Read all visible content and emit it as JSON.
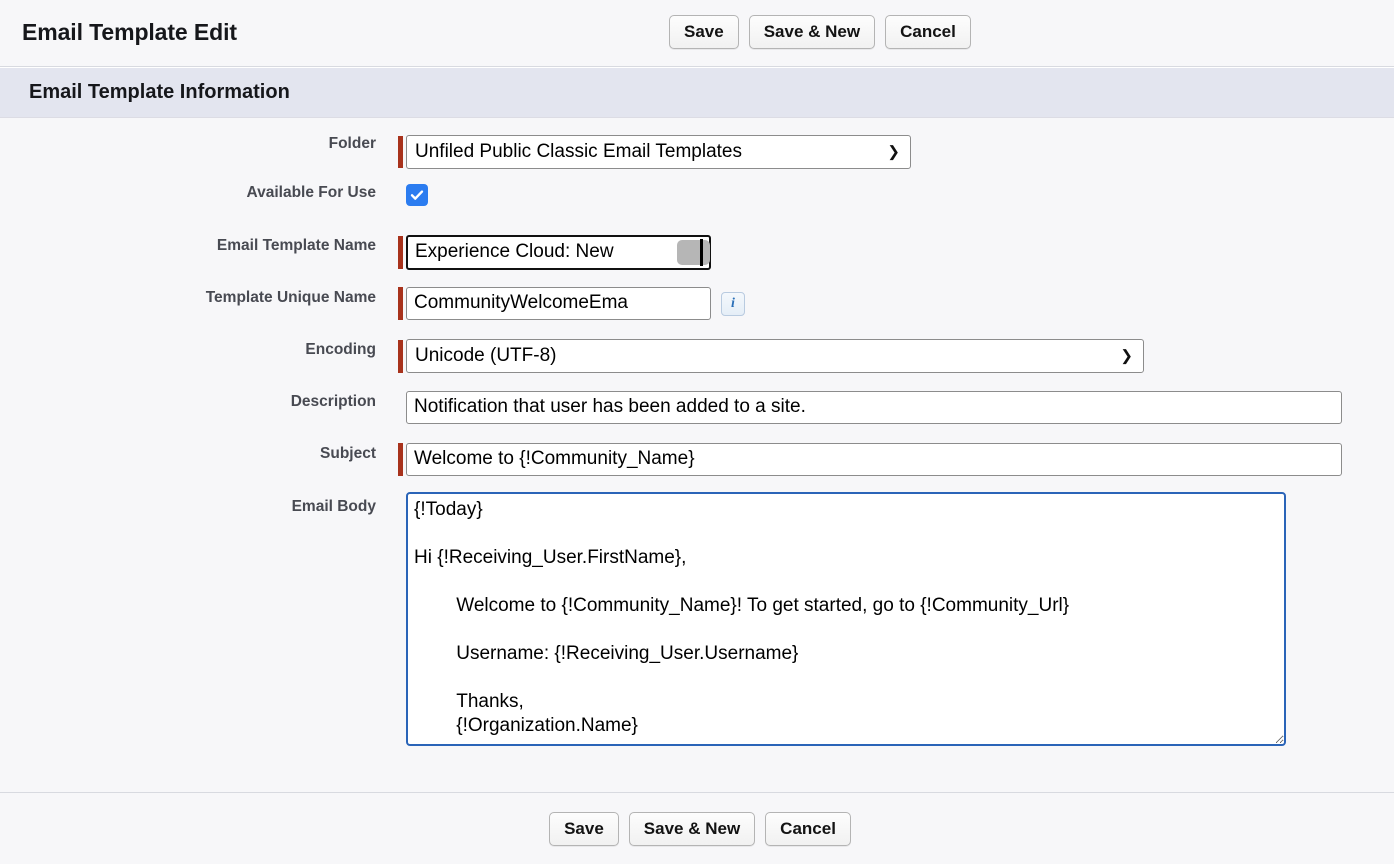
{
  "header": {
    "title": "Email Template Edit",
    "buttons": [
      {
        "label": "Save",
        "name": "save-button"
      },
      {
        "label": "Save & New",
        "name": "save-and-new-button"
      },
      {
        "label": "Cancel",
        "name": "cancel-button"
      }
    ]
  },
  "section": {
    "title": "Email Template Information"
  },
  "fields": {
    "folder": {
      "label": "Folder",
      "value": "Unfiled Public Classic Email Templates",
      "required": true,
      "arrow": "chevron-down-icon"
    },
    "available_for_use": {
      "label": "Available For Use",
      "checked": true,
      "required": false
    },
    "email_template_name": {
      "label": "Email Template Name",
      "value": "Experience Cloud: New ",
      "required": true,
      "focused": true
    },
    "template_unique_name": {
      "label": "Template Unique Name",
      "value": "CommunityWelcomeEma",
      "required": true,
      "info_icon": "info-icon",
      "info_label": "i"
    },
    "encoding": {
      "label": "Encoding",
      "value": "Unicode (UTF-8)",
      "required": true,
      "options": [
        "Unicode (UTF-8)"
      ],
      "arrow": "chevron-down-icon"
    },
    "description": {
      "label": "Description",
      "value": "Notification that user has been added to a site.",
      "required": false
    },
    "subject": {
      "label": "Subject",
      "value": "Welcome to {!Community_Name}",
      "required": true
    },
    "email_body": {
      "label": "Email Body",
      "value": "{!Today}\n\nHi {!Receiving_User.FirstName},\n\n\tWelcome to {!Community_Name}! To get started, go to {!Community_Url}\n\n\tUsername: {!Receiving_User.Username}\n\n\tThanks,\n\t{!Organization.Name}",
      "required": false,
      "focused": true
    }
  },
  "footer": {
    "buttons": [
      {
        "label": "Save",
        "name": "footer-save-button"
      },
      {
        "label": "Save & New",
        "name": "footer-save-and-new-button"
      },
      {
        "label": "Cancel",
        "name": "footer-cancel-button"
      }
    ]
  },
  "colors": {
    "required_marker": "#a8321c",
    "section_band": "#e3e5ef",
    "page_background": "#f7f7f9",
    "checkbox_accent": "#2b7cf0",
    "focus_border": "#2a64b8"
  }
}
